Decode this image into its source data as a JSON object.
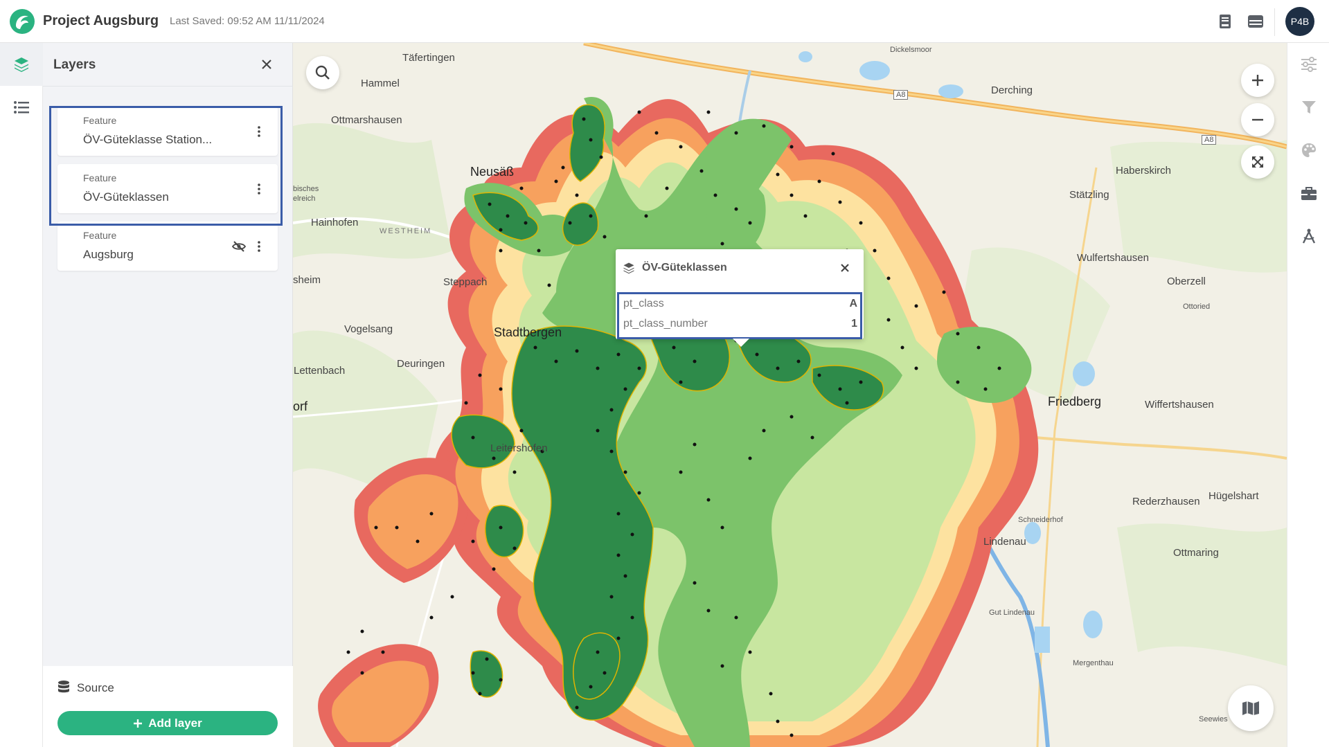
{
  "header": {
    "title": "Project Augsburg",
    "last_saved": "Last Saved: 09:52 AM 11/11/2024",
    "avatar_initials": "P4B",
    "icons": [
      "book-icon",
      "table-icon"
    ]
  },
  "rail": {
    "items": [
      {
        "icon": "layers-icon",
        "active": true
      },
      {
        "icon": "list-icon",
        "active": false
      }
    ]
  },
  "panel": {
    "title": "Layers",
    "layers": [
      {
        "type": "Feature",
        "name": "ÖV-Güteklasse Station...",
        "hidden": false
      },
      {
        "type": "Feature",
        "name": "ÖV-Güteklassen",
        "hidden": false
      },
      {
        "type": "Feature",
        "name": "Augsburg",
        "hidden": true
      }
    ],
    "source_label": "Source",
    "add_layer_label": "Add layer"
  },
  "popup": {
    "title": "ÖV-Güteklassen",
    "rows": [
      {
        "key": "pt_class",
        "value": "A"
      },
      {
        "key": "pt_class_number",
        "value": "1"
      }
    ]
  },
  "map": {
    "labels": [
      "Täfertingen",
      "Hammel",
      "Ottmarshausen",
      "Neusäß",
      "Hainhofen",
      "WESTHEIM",
      "Steppach",
      "Stadtbergen",
      "Vogelsang",
      "Deuringen",
      "Lettenbach",
      "Leitershofen",
      "Derching",
      "Haberskirch",
      "Stätzling",
      "Wulfertshausen",
      "Oberzell",
      "Ottoried",
      "Friedberg",
      "Wiffertshausen",
      "Rederzhausen",
      "Hügelshart",
      "Schneiderhof",
      "Lindenau",
      "Ottmaring",
      "Gut Lindenau",
      "Mergenthau",
      "Seewies",
      "Dickelsmoor",
      "A8",
      "bisches",
      "elreich",
      "sheim",
      "orf"
    ],
    "colors": {
      "class_a": "#2e8b4a",
      "class_b": "#7cc36a",
      "class_c": "#c8e6a0",
      "class_d": "#fde2a0",
      "class_e": "#f7a15e",
      "class_f": "#e8695f",
      "station_dot": "#111111",
      "highlight": "#3a5ca8",
      "accent": "#2bb381"
    }
  },
  "right_tools": [
    "sliders-icon",
    "filter-icon",
    "palette-icon",
    "toolbox-icon",
    "compass-icon"
  ]
}
